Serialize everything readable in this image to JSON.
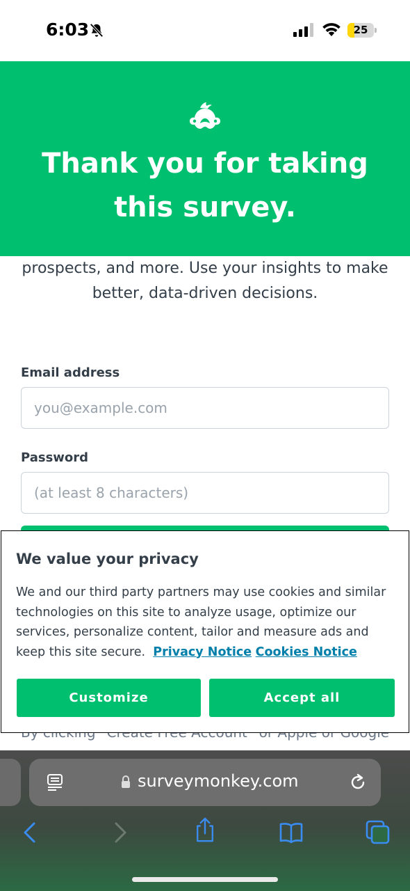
{
  "status_bar": {
    "time": "6:03",
    "battery": "25",
    "battery_level": 0.25,
    "icons": [
      "bell-slash-icon",
      "cellular-signal-icon",
      "wifi-icon",
      "battery-icon"
    ]
  },
  "hero": {
    "logo": "surveymonkey-logo-icon",
    "title": "Thank you for taking this survey.",
    "background_color": "#00bf6f"
  },
  "intro": {
    "text": "prospects, and more. Use your insights to make better, data-driven decisions."
  },
  "form": {
    "email_label": "Email address",
    "email_placeholder": "you@example.com",
    "password_label": "Password",
    "password_placeholder": "(at least 8 characters)",
    "legal_peek": "By clicking “Create Free Account” or Apple or Google,"
  },
  "cookie_modal": {
    "title": "We value your privacy",
    "body": "We and our third party partners may use cookies and similar technologies on this site to analyze usage, optimize our services, personalize content, tailor and measure ads and keep this site secure.",
    "privacy_link": "Privacy Notice",
    "cookies_link": "Cookies Notice",
    "customize_label": "Customize",
    "accept_label": "Accept all",
    "link_color": "#007faa"
  },
  "browser": {
    "url": "surveymonkey.com",
    "icons": [
      "reader-icon",
      "lock-icon",
      "reload-icon",
      "back-icon",
      "forward-icon",
      "share-icon",
      "bookmarks-icon",
      "tabs-icon"
    ]
  }
}
